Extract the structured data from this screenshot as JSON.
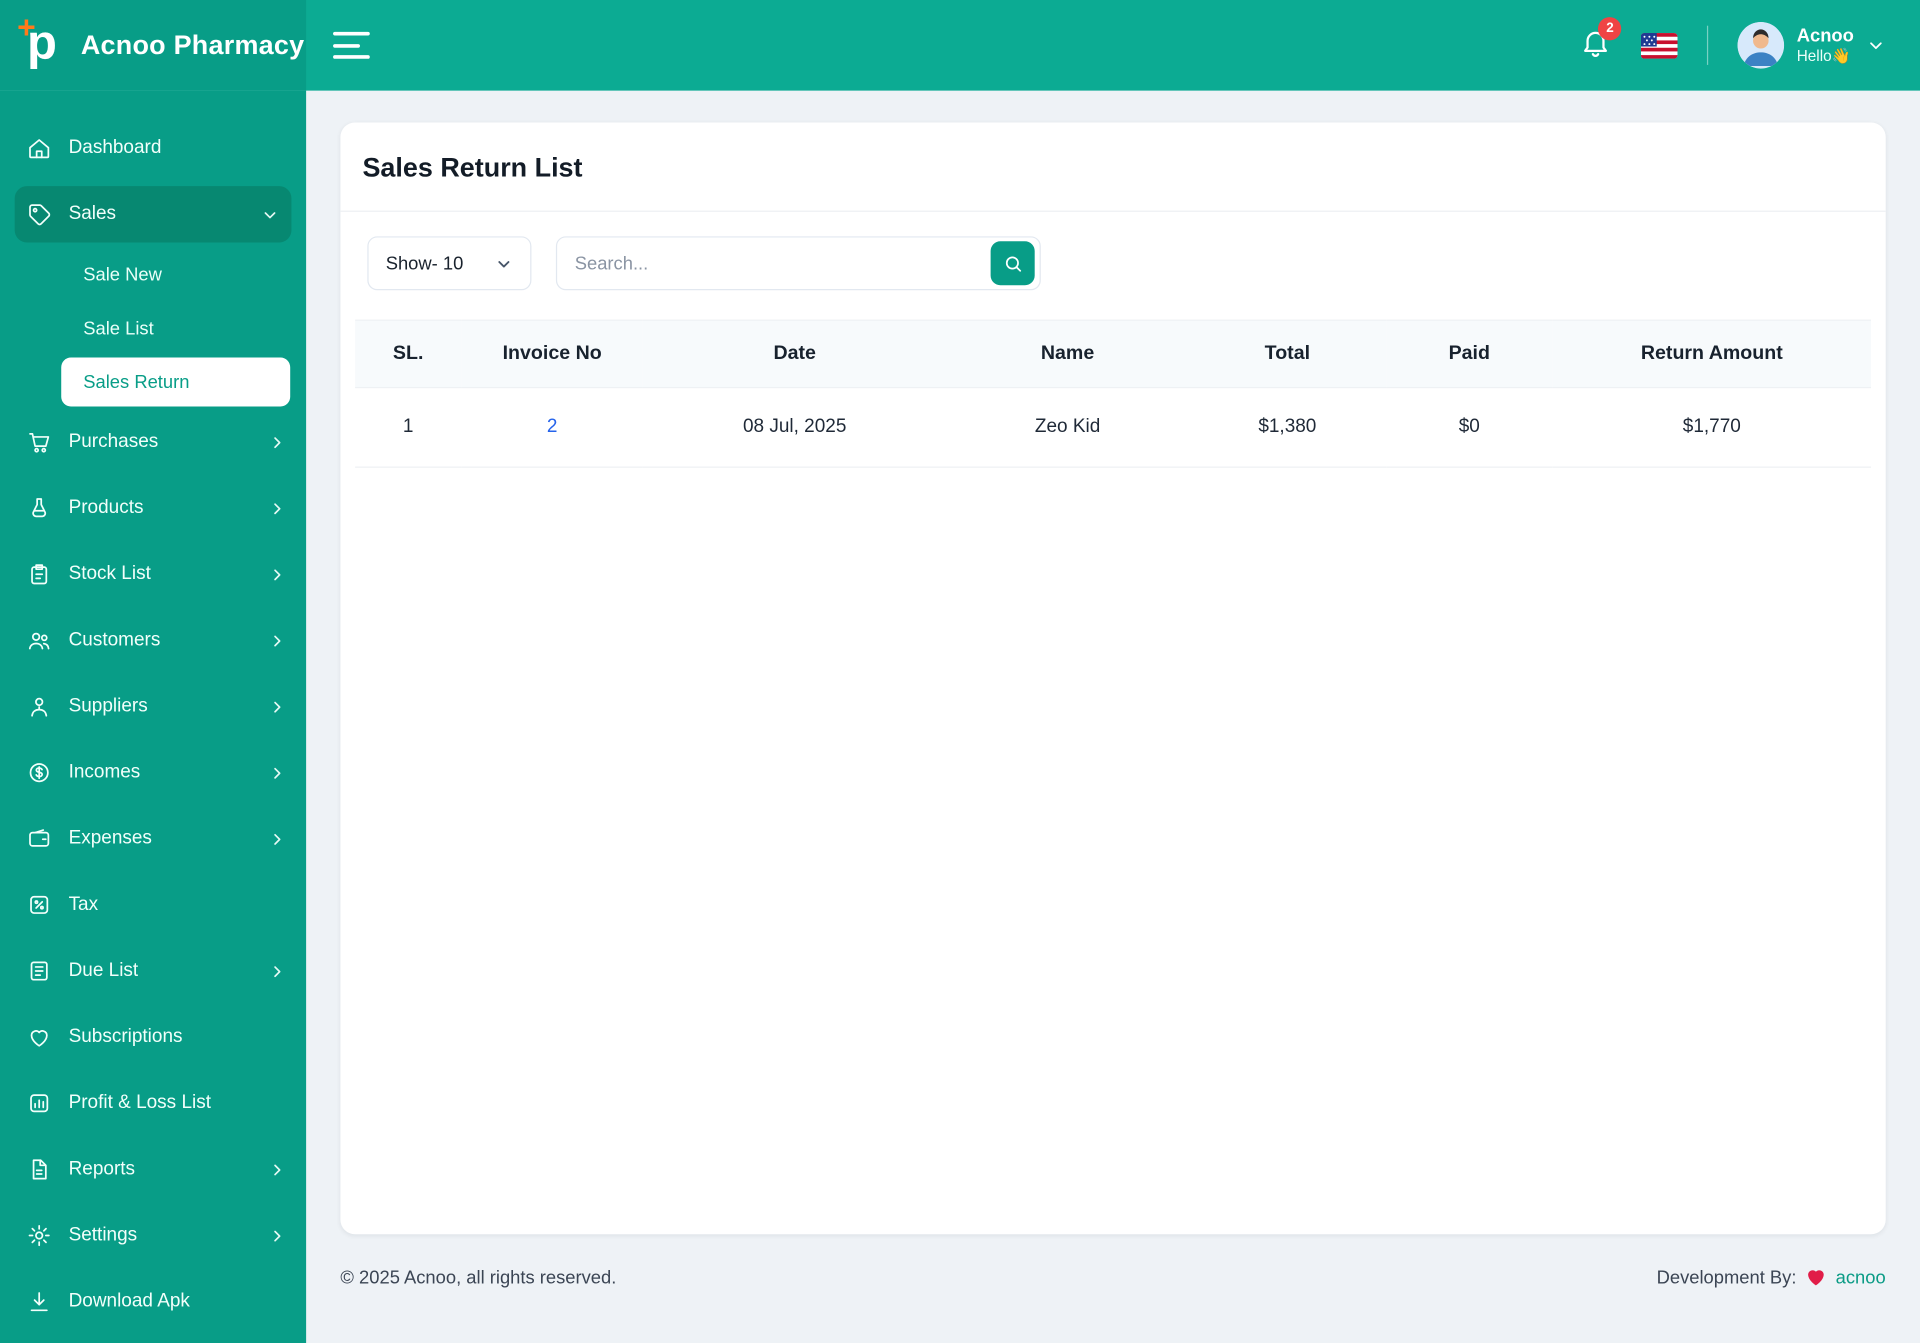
{
  "colors": {
    "teal_sidebar": "#089d87",
    "teal_header": "#0cab93",
    "teal_dark": "#078871",
    "link_blue": "#2563eb",
    "badge_red": "#ef4444"
  },
  "brand": {
    "name": "Acnoo Pharmacy",
    "logo_icon": "plus-p-logo-icon"
  },
  "header": {
    "menu_icon": "hamburger-icon",
    "notification_count": "2",
    "flag_icon": "us-flag-icon",
    "user_name": "Acnoo",
    "greeting": "Hello",
    "greeting_emoji": "👋"
  },
  "sidebar": {
    "items": [
      {
        "label": "Dashboard",
        "icon": "home-icon",
        "chevron": "none"
      },
      {
        "label": "Sales",
        "icon": "sales-tag-icon",
        "chevron": "down",
        "expanded": true,
        "children": [
          {
            "label": "Sale New",
            "active": false
          },
          {
            "label": "Sale List",
            "active": false
          },
          {
            "label": "Sales Return",
            "active": true
          }
        ]
      },
      {
        "label": "Purchases",
        "icon": "purchases-cart-icon",
        "chevron": "right"
      },
      {
        "label": "Products",
        "icon": "products-flask-icon",
        "chevron": "right"
      },
      {
        "label": "Stock List",
        "icon": "stock-clipboard-icon",
        "chevron": "right"
      },
      {
        "label": "Customers",
        "icon": "customers-users-icon",
        "chevron": "right"
      },
      {
        "label": "Suppliers",
        "icon": "suppliers-person-icon",
        "chevron": "right"
      },
      {
        "label": "Incomes",
        "icon": "incomes-coin-icon",
        "chevron": "right"
      },
      {
        "label": "Expenses",
        "icon": "expenses-wallet-icon",
        "chevron": "right"
      },
      {
        "label": "Tax",
        "icon": "tax-percent-icon",
        "chevron": "none"
      },
      {
        "label": "Due List",
        "icon": "due-list-icon",
        "chevron": "right"
      },
      {
        "label": "Subscriptions",
        "icon": "subscriptions-heart-icon",
        "chevron": "none"
      },
      {
        "label": "Profit & Loss List",
        "icon": "profit-loss-chart-icon",
        "chevron": "none"
      },
      {
        "label": "Reports",
        "icon": "reports-file-icon",
        "chevron": "right"
      },
      {
        "label": "Settings",
        "icon": "settings-gear-icon",
        "chevron": "right"
      },
      {
        "label": "Download Apk",
        "icon": "download-icon",
        "chevron": "none"
      }
    ]
  },
  "main": {
    "title": "Sales Return List",
    "show_select": "Show- 10",
    "search_placeholder": "Search...",
    "table": {
      "headers": [
        "SL.",
        "Invoice No",
        "Date",
        "Name",
        "Total",
        "Paid",
        "Return Amount"
      ],
      "rows": [
        {
          "sl": "1",
          "invoice": "2",
          "date": "08 Jul, 2025",
          "name": "Zeo Kid",
          "total": "$1,380",
          "paid": "$0",
          "return_amount": "$1,770"
        }
      ]
    }
  },
  "footer": {
    "copyright": "© 2025 Acnoo, all rights reserved.",
    "dev_prefix": "Development By:",
    "dev_name": "acnoo"
  }
}
